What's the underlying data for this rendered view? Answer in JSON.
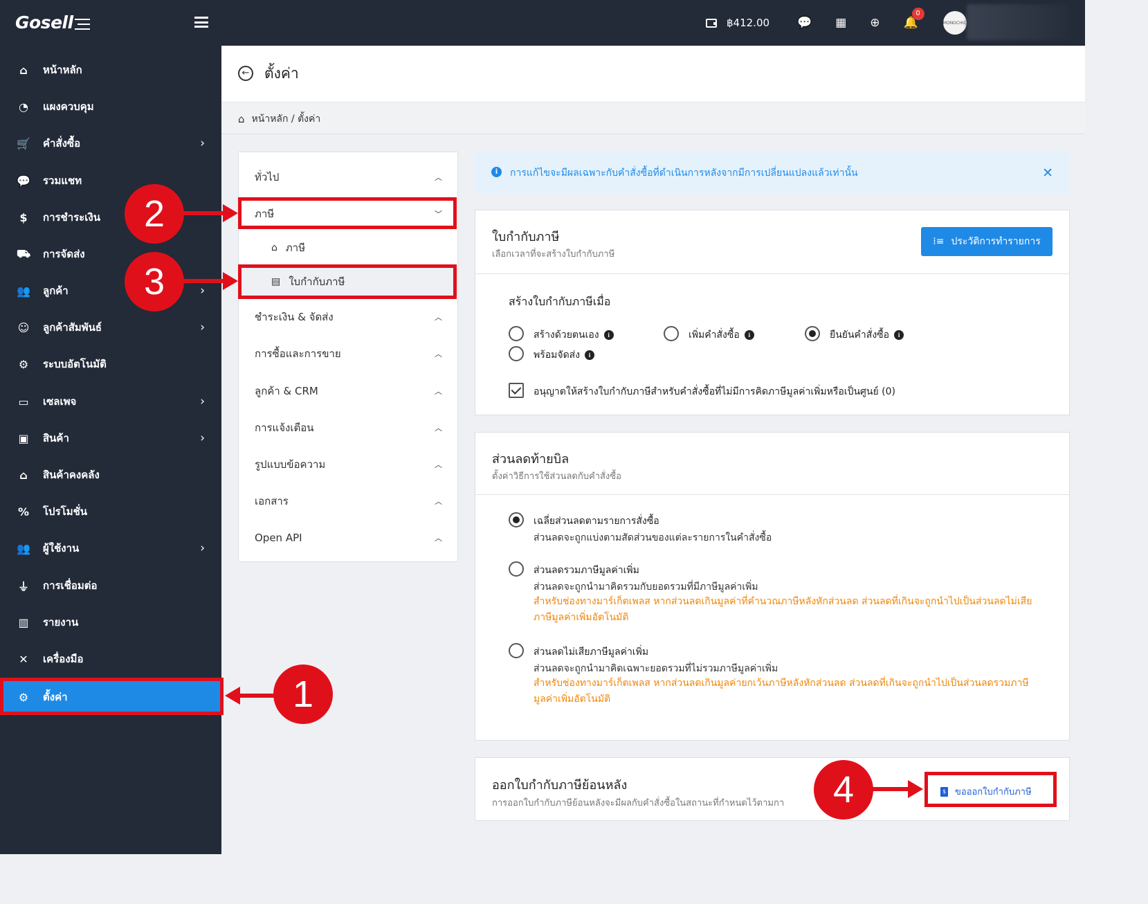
{
  "topbar": {
    "logo": "Gosell",
    "balance": "฿412.00",
    "notification_count": "0",
    "avatar_text": "MONOCHIC"
  },
  "sidebar": {
    "items": [
      {
        "label": "หน้าหลัก",
        "icon": "home-icon",
        "chevron": false
      },
      {
        "label": "แผงควบคุม",
        "icon": "dashboard-icon",
        "chevron": false
      },
      {
        "label": "คำสั่งซื้อ",
        "icon": "cart-icon",
        "chevron": true
      },
      {
        "label": "รวมแชท",
        "icon": "chat-icon",
        "chevron": false
      },
      {
        "label": "การชำระเงิน",
        "icon": "money-bag-icon",
        "chevron": false
      },
      {
        "label": "การจัดส่ง",
        "icon": "truck-icon",
        "chevron": false
      },
      {
        "label": "ลูกค้า",
        "icon": "customers-icon",
        "chevron": true
      },
      {
        "label": "ลูกค้าสัมพันธ์",
        "icon": "crm-icon",
        "chevron": true
      },
      {
        "label": "ระบบอัตโนมัติ",
        "icon": "robot-icon",
        "chevron": false
      },
      {
        "label": "เซลเพจ",
        "icon": "salepage-icon",
        "chevron": true
      },
      {
        "label": "สินค้า",
        "icon": "products-icon",
        "chevron": true
      },
      {
        "label": "สินค้าคงคลัง",
        "icon": "warehouse-icon",
        "chevron": false
      },
      {
        "label": "โปรโมชั่น",
        "icon": "percent-icon",
        "chevron": false
      },
      {
        "label": "ผู้ใช้งาน",
        "icon": "users-icon",
        "chevron": true
      },
      {
        "label": "การเชื่อมต่อ",
        "icon": "plug-icon",
        "chevron": false
      },
      {
        "label": "รายงาน",
        "icon": "report-icon",
        "chevron": false
      },
      {
        "label": "เครื่องมือ",
        "icon": "tools-icon",
        "chevron": false
      },
      {
        "label": "ตั้งค่า",
        "icon": "gear-icon",
        "chevron": false
      }
    ]
  },
  "page": {
    "title": "ตั้งค่า",
    "breadcrumb": "หน้าหลัก / ตั้งค่า"
  },
  "settings_nav": {
    "general": "ทั่วไป",
    "tax": "ภาษี",
    "tax_sub": "ภาษี",
    "tax_invoice_sub": "ใบกำกับภาษี",
    "payment_shipping": "ชำระเงิน & จัดส่ง",
    "buy_sell": "การซื้อและการขาย",
    "customer_crm": "ลูกค้า & CRM",
    "notifications": "การแจ้งเตือน",
    "message_format": "รูปแบบข้อความ",
    "documents": "เอกสาร",
    "open_api": "Open API"
  },
  "alert": {
    "text": "การแก้ไขจะมีผลเฉพาะกับคำสั่งซื้อที่ดำเนินการหลังจากมีการเปลี่ยนแปลงแล้วเท่านั้น"
  },
  "tax_invoice_card": {
    "title": "ใบกำกับภาษี",
    "subtitle": "เลือกเวลาที่จะสร้างใบกำกับภาษี",
    "history_button": "ประวัติการทำรายการ",
    "create_when_label": "สร้างใบกำกับภาษีเมื่อ",
    "options": [
      "สร้างด้วยตนเอง",
      "เพิ่มคำสั่งซื้อ",
      "ยืนยันคำสั่งซื้อ",
      "พร้อมจัดส่ง"
    ],
    "selected": "ยืนยันคำสั่งซื้อ",
    "allow_zero_vat": "อนุญาตให้สร้างใบกำกับภาษีสำหรับคำสั่งซื้อที่ไม่มีการคิดภาษีมูลค่าเพิ่มหรือเป็นศูนย์ (0)"
  },
  "discount_card": {
    "title": "ส่วนลดท้ายบิล",
    "subtitle": "ตั้งค่าวิธีการใช้ส่วนลดกับคำสั่งซื้อ",
    "options": [
      {
        "label": "เฉลี่ยส่วนลดตามรายการสั่งซื้อ",
        "desc": "ส่วนลดจะถูกแบ่งตามสัดส่วนของแต่ละรายการในคำสั่งซื้อ",
        "warn": ""
      },
      {
        "label": "ส่วนลดรวมภาษีมูลค่าเพิ่ม",
        "desc": "ส่วนลดจะถูกนำมาคิดรวมกับยอดรวมที่มีภาษีมูลค่าเพิ่ม",
        "warn": "สำหรับช่องทางมาร์เก็ตเพลส หากส่วนลดเกินมูลค่าที่คำนวณภาษีหลังหักส่วนลด ส่วนลดที่เกินจะถูกนำไปเป็นส่วนลดไม่เสียภาษีมูลค่าเพิ่มอัตโนมัติ"
      },
      {
        "label": "ส่วนลดไม่เสียภาษีมูลค่าเพิ่ม",
        "desc": "ส่วนลดจะถูกนำมาคิดเฉพาะยอดรวมที่ไม่รวมภาษีมูลค่าเพิ่ม",
        "warn": "สำหรับช่องทางมาร์เก็ตเพลส หากส่วนลดเกินมูลค่ายกเว้นภาษีหลังหักส่วนลด ส่วนลดที่เกินจะถูกนำไปเป็นส่วนลดรวมภาษีมูลค่าเพิ่มอัตโนมัติ"
      }
    ]
  },
  "retro_card": {
    "title": "ออกใบกำกับภาษีย้อนหลัง",
    "subtitle": "การออกใบกำกับภาษีย้อนหลังจะมีผลกับคำสั่งซื้อในสถานะที่กำหนดไว้ตามกา",
    "request_button": "ขอออกใบกำกับภาษี"
  },
  "annotations": [
    "1",
    "2",
    "3",
    "4"
  ],
  "colors": {
    "sidebar": "#232a38",
    "accent": "#1f8ae6",
    "annotation": "#e0101b",
    "warning": "#f0860a"
  }
}
